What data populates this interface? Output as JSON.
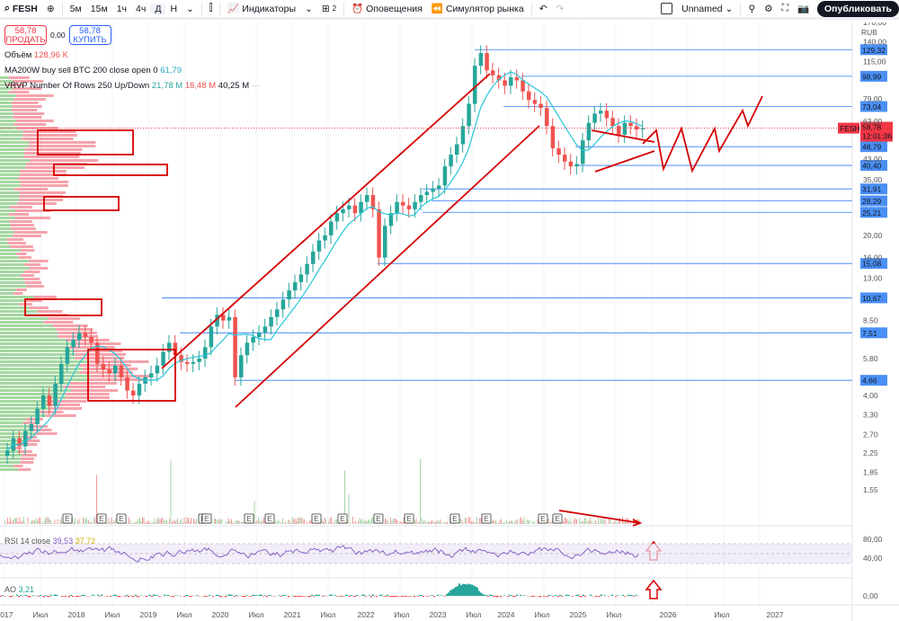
{
  "toolbar": {
    "symbol": "FESH",
    "intervals": [
      "5м",
      "15м",
      "1ч",
      "4ч",
      "Д",
      "Н"
    ],
    "active_interval": "Д",
    "indicators": "Индикаторы",
    "layouts_count": "2",
    "alerts": "Оповещения",
    "replay": "Симулятор рынка",
    "layout_name": "Unnamed",
    "publish": "Опубликовать"
  },
  "trade": {
    "sell_price": "58,78",
    "sell_label": "ПРОДАТЬ",
    "spread": "0,00",
    "buy_price": "58,78",
    "buy_label": "КУПИТЬ"
  },
  "legend": {
    "volume_label": "Объём",
    "volume_value": "128,96 K",
    "ma_label": "MA200W buy sell BTC 200 close open 0",
    "ma_value": "61,79",
    "vrvp_label": "VRVP Number Of Rows 250 Up/Down",
    "vrvp_up": "21,78 M",
    "vrvp_down": "18,48 M",
    "vrvp_total": "40,25 M",
    "rsi_label": "RSI 14 close",
    "rsi_value": "39,53",
    "rsi_ma": "37,72",
    "ao_label": "AO",
    "ao_value": "3,21"
  },
  "colors": {
    "up": "#26a69a",
    "down": "#ef5350",
    "level": "#2f7df6",
    "annotation": "#d50000",
    "ma": "#26c6da",
    "rsi": "#7e57c2"
  },
  "chart_data": {
    "type": "candlestick",
    "currency": "RUB",
    "scale": "log",
    "price_ticks": [
      "170,00",
      "140,00",
      "115,00",
      "79,00",
      "63,00",
      "43,00",
      "35,00",
      "20,00",
      "16,00",
      "13,00",
      "8,50",
      "5,80",
      "4,00",
      "3,30",
      "2,70",
      "2,25",
      "1,85",
      "1,55"
    ],
    "levels": [
      "129,32",
      "98,99",
      "73,04",
      "48,79",
      "40,40",
      "31,91",
      "28,29",
      "25,21",
      "15,08",
      "10,67",
      "7,51",
      "4,66"
    ],
    "last": {
      "symbol": "FESH",
      "price": "58,78",
      "countdown": "12:01:36"
    },
    "rsi_ticks": [
      "80,00",
      "40,00"
    ],
    "ao_ticks": [
      "0,00"
    ],
    "x_labels": [
      "2017",
      "Июл",
      "2018",
      "Июл",
      "2019",
      "Июл",
      "2020",
      "Июл",
      "2021",
      "Июл",
      "2022",
      "Июл",
      "2023",
      "Июл",
      "2024",
      "Июл",
      "2025",
      "Июл",
      "2026",
      "Июл",
      "2027"
    ],
    "start": "2017-01",
    "monthly_close": [
      2.3,
      2.6,
      2.4,
      2.8,
      3.0,
      3.5,
      4.0,
      3.6,
      4.5,
      5.5,
      6.5,
      7.0,
      7.5,
      7.2,
      6.8,
      5.5,
      5.2,
      5.0,
      5.4,
      4.8,
      4.2,
      4.0,
      4.5,
      4.8,
      5.0,
      5.4,
      6.2,
      6.8,
      6.0,
      5.6,
      5.5,
      5.6,
      5.8,
      6.5,
      8.0,
      9.0,
      8.5,
      8.8,
      4.8,
      6.0,
      6.8,
      7.2,
      7.5,
      8.0,
      8.8,
      9.5,
      10.5,
      11.5,
      12.5,
      13.5,
      15,
      17,
      19,
      20,
      23,
      25,
      26,
      27,
      25,
      28,
      30,
      26,
      16,
      22,
      25,
      28,
      27,
      26,
      28,
      30,
      31,
      32,
      33,
      40,
      45,
      50,
      60,
      75,
      110,
      125,
      105,
      100,
      95,
      90,
      98,
      95,
      85,
      78,
      75,
      72,
      60,
      48,
      45,
      42,
      40,
      41,
      52,
      62,
      68,
      70,
      65,
      60,
      55,
      62,
      60,
      58,
      58.78
    ],
    "earnings_marker": "E"
  }
}
